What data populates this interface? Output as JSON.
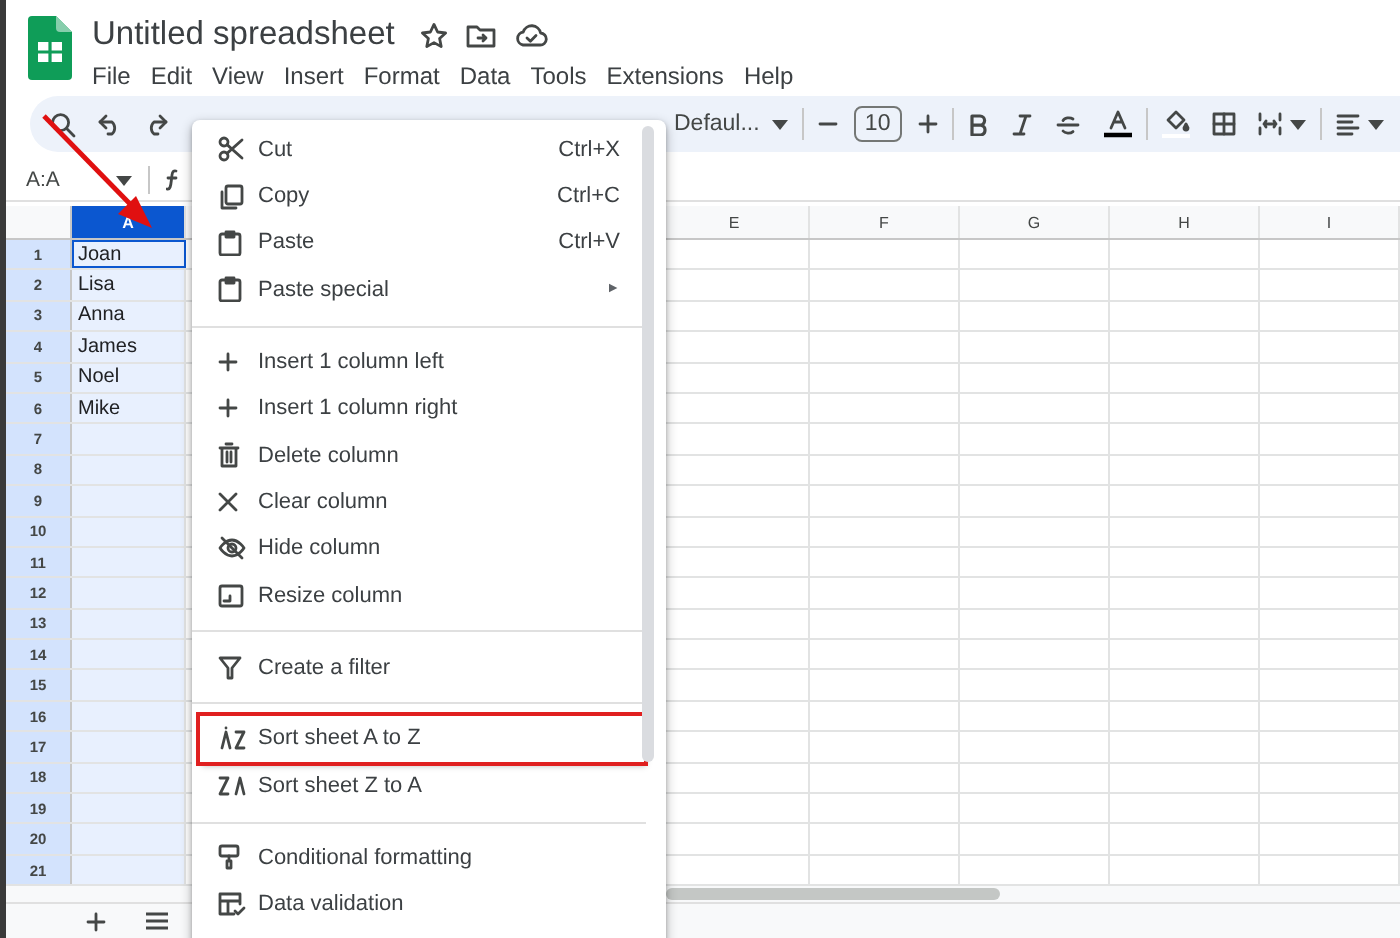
{
  "app": {
    "title": "Untitled spreadsheet"
  },
  "menu_bar": [
    "File",
    "Edit",
    "View",
    "Insert",
    "Format",
    "Data",
    "Tools",
    "Extensions",
    "Help"
  ],
  "toolbar": {
    "font": "Defaul...",
    "font_size": "10"
  },
  "formula_bar": {
    "name_box": "A:A"
  },
  "sheet": {
    "columns": [
      {
        "label": "A",
        "selected": true
      },
      {
        "label": "E",
        "selected": false
      },
      {
        "label": "F",
        "selected": false
      },
      {
        "label": "G",
        "selected": false
      },
      {
        "label": "H",
        "selected": false
      },
      {
        "label": "I",
        "selected": false
      }
    ],
    "rows": [
      {
        "number": "1",
        "cells": [
          "Joan"
        ]
      },
      {
        "number": "2",
        "cells": [
          "Lisa"
        ]
      },
      {
        "number": "3",
        "cells": [
          "Anna"
        ]
      },
      {
        "number": "4",
        "cells": [
          "James"
        ]
      },
      {
        "number": "5",
        "cells": [
          "Noel"
        ]
      },
      {
        "number": "6",
        "cells": [
          "Mike"
        ]
      },
      {
        "number": "7"
      },
      {
        "number": "8"
      },
      {
        "number": "9"
      },
      {
        "number": "10"
      },
      {
        "number": "11"
      },
      {
        "number": "12"
      },
      {
        "number": "13"
      },
      {
        "number": "14"
      },
      {
        "number": "15"
      },
      {
        "number": "16"
      },
      {
        "number": "17"
      },
      {
        "number": "18"
      },
      {
        "number": "19"
      },
      {
        "number": "20"
      },
      {
        "number": "21"
      }
    ]
  },
  "context_menu": {
    "items": [
      {
        "kind": "item",
        "label": "Cut",
        "shortcut": "Ctrl+X",
        "highlighted": false
      },
      {
        "kind": "item",
        "label": "Copy",
        "shortcut": "Ctrl+C",
        "highlighted": false
      },
      {
        "kind": "item",
        "label": "Paste",
        "shortcut": "Ctrl+V",
        "highlighted": false
      },
      {
        "kind": "submenu",
        "label": "Paste special",
        "arrow": "►",
        "highlighted": false
      },
      {
        "kind": "divider"
      },
      {
        "kind": "item",
        "label": "Insert 1 column left",
        "highlighted": false
      },
      {
        "kind": "item",
        "label": "Insert 1 column right",
        "highlighted": false
      },
      {
        "kind": "item",
        "label": "Delete column",
        "highlighted": false
      },
      {
        "kind": "item",
        "label": "Clear column",
        "highlighted": false
      },
      {
        "kind": "item",
        "label": "Hide column",
        "highlighted": false
      },
      {
        "kind": "item",
        "label": "Resize column",
        "highlighted": false
      },
      {
        "kind": "divider"
      },
      {
        "kind": "item",
        "label": "Create a filter",
        "highlighted": false
      },
      {
        "kind": "divider"
      },
      {
        "kind": "item",
        "label": "Sort sheet A to Z",
        "highlighted": true
      },
      {
        "kind": "item",
        "label": "Sort sheet Z to A",
        "highlighted": false
      },
      {
        "kind": "divider"
      },
      {
        "kind": "item",
        "label": "Conditional formatting",
        "highlighted": false
      },
      {
        "kind": "item",
        "label": "Data validation",
        "highlighted": false
      }
    ]
  }
}
